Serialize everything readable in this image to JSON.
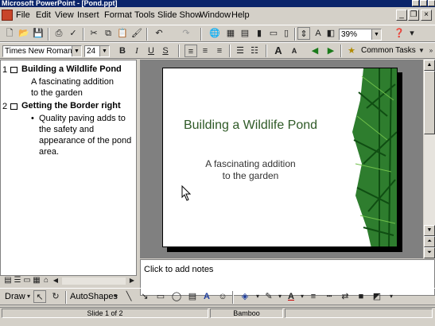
{
  "window": {
    "title": "Microsoft PowerPoint - [Pond.ppt]"
  },
  "menu": [
    "File",
    "Edit",
    "View",
    "Insert",
    "Format",
    "Tools",
    "Slide Show",
    "Window",
    "Help"
  ],
  "standard_toolbar": {
    "zoom": "39%"
  },
  "formatting_toolbar": {
    "font": "Times New Roman",
    "size": "24",
    "common_tasks": "Common Tasks"
  },
  "outline": {
    "slides": [
      {
        "number": "1",
        "title": "Building a Wildlife Pond",
        "body": [
          "A fascinating addition",
          "to the garden"
        ]
      },
      {
        "number": "2",
        "title": "Getting the Border right",
        "bullets": [
          "Quality paving adds to",
          "the safety and",
          "appearance of the pond",
          "area."
        ]
      }
    ]
  },
  "slide": {
    "title": "Building a Wildlife Pond",
    "subtitle_line1": "A fascinating addition",
    "subtitle_line2": "to the garden"
  },
  "notes": {
    "placeholder": "Click to add notes"
  },
  "draw_toolbar": {
    "draw": "Draw",
    "autoshapes": "AutoShapes"
  },
  "status": {
    "slide_pos": "Slide 1 of 2",
    "design": "Bamboo"
  },
  "colors": {
    "title_bar": "#0a246a",
    "slide_title": "#2f5a27",
    "chrome": "#d4d0c8"
  }
}
